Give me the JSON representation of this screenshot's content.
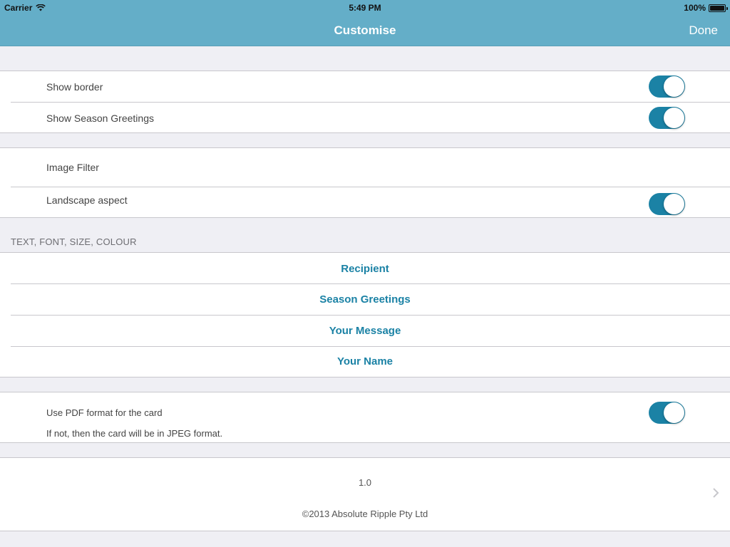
{
  "status_bar": {
    "carrier": "Carrier",
    "time": "5:49 PM",
    "battery": "100%",
    "wifi_icon": "wifi-icon",
    "battery_icon": "battery-icon"
  },
  "nav": {
    "title": "Customise",
    "done_label": "Done"
  },
  "group1": {
    "show_border_label": "Show border",
    "show_border_on": true,
    "show_greetings_label": "Show Season Greetings",
    "show_greetings_on": true
  },
  "group2": {
    "image_filter_label": "Image Filter",
    "landscape_label": "Landscape aspect",
    "landscape_on": true
  },
  "text_section": {
    "header": "TEXT, FONT, SIZE, COLOUR",
    "items": [
      "Recipient",
      "Season Greetings",
      "Your Message",
      "Your Name"
    ]
  },
  "pdf_group": {
    "label": "Use PDF format for the card",
    "on": true,
    "note": "If not, then the card will be in JPEG format."
  },
  "about": {
    "version": "1.0",
    "copyright": "©2013 Absolute Ripple Pty Ltd"
  },
  "colors": {
    "nav_bar": "#64aec8",
    "accent": "#1b82a5",
    "background": "#efeff4"
  }
}
